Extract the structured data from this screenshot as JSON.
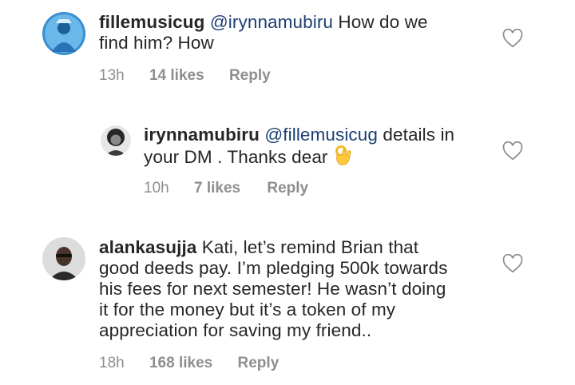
{
  "comments": [
    {
      "username": "fillemusicug",
      "mention": "@irynnamubiru",
      "text_line1": " How do we",
      "text_line2": "find him?  How",
      "time": "13h",
      "likes": "14 likes",
      "reply": "Reply",
      "avatar_icon": "profile-photo-blue"
    },
    {
      "username": "irynnamubiru",
      "mention": "@fillemusicug",
      "text_line1": " details in",
      "text_line2": "your  DM . Thanks dear",
      "emoji": "ok-hand-emoji",
      "time": "10h",
      "likes": "7 likes",
      "reply": "Reply",
      "avatar_icon": "profile-photo-bw"
    },
    {
      "username": "alankasujja",
      "text_line1": " Kati, let’s remind Brian that",
      "text_line2": "good deeds pay. I’m pledging 500k towards",
      "text_line3": "his fees for next semester!  He wasn’t doing",
      "text_line4": "it for the money but it’s a token of my",
      "text_line5": "appreciation for saving my friend..",
      "time": "18h",
      "likes": "168 likes",
      "reply": "Reply",
      "avatar_icon": "profile-photo-man"
    }
  ],
  "icons": {
    "like": "heart-outline-icon"
  },
  "colors": {
    "text": "#262626",
    "mention": "#1c3f73",
    "meta": "#8e8e8e"
  }
}
